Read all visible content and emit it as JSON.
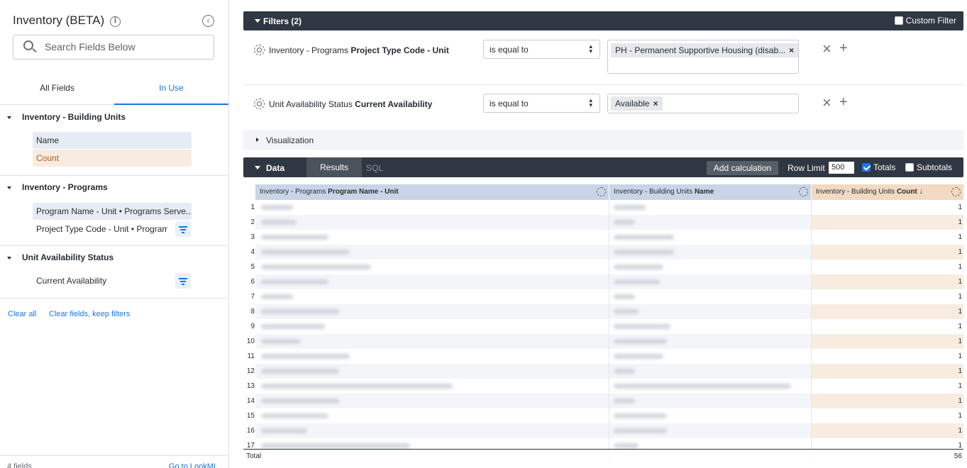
{
  "left_panel": {
    "title": "Inventory (BETA)",
    "info_glyph": "i",
    "collapse_glyph": "‹",
    "search_placeholder": "Search Fields Below",
    "tabs": {
      "all": "All Fields",
      "in_use": "In Use"
    },
    "groups": [
      {
        "title": "Inventory - Building Units",
        "fields": [
          "Name",
          "Count"
        ]
      },
      {
        "title": "Inventory - Programs",
        "fields": [
          "Program Name - Unit • Programs Serve...",
          "Project Type Code - Unit • Program..."
        ]
      },
      {
        "title": "Unit Availability Status",
        "fields": [
          "Current Availability"
        ]
      }
    ],
    "clear_all": "Clear all",
    "clear_fields": "Clear fields, keep filters",
    "fields_count": "4 fields",
    "go_to_lookml": "Go to LookML"
  },
  "filters": {
    "title": "Filters (2)",
    "custom_filter": "Custom Filter",
    "rows": [
      {
        "label_prefix": "Inventory - Programs ",
        "label_field": "Project Type Code - Unit",
        "operator": "is equal to",
        "value": "PH - Permanent Supportive Housing (disab..."
      },
      {
        "label_prefix": "Unit Availability Status ",
        "label_field": "Current Availability",
        "operator": "is equal to",
        "value": "Available"
      }
    ],
    "remove_glyph": "×",
    "add_glyph": "+",
    "select_arrows": "▲▼"
  },
  "visualization": {
    "label": "Visualization"
  },
  "data_bar": {
    "title": "Data",
    "tab_results": "Results",
    "tab_sql": "SQL",
    "add_calculation": "Add calculation",
    "row_limit_label": "Row Limit",
    "row_limit_value": "500",
    "totals": "Totals",
    "subtotals": "Subtotals",
    "totals_checked": true,
    "subtotals_checked": false
  },
  "table": {
    "columns": [
      {
        "prefix": "Inventory - Programs ",
        "field": "Program Name - Unit"
      },
      {
        "prefix": "Inventory - Building Units ",
        "field": "Name"
      },
      {
        "prefix": "Inventory - Building Units ",
        "field": "Count ↓"
      }
    ],
    "rows": [
      {
        "n": "1",
        "count": "1"
      },
      {
        "n": "2",
        "count": "1"
      },
      {
        "n": "3",
        "count": "1"
      },
      {
        "n": "4",
        "count": "1"
      },
      {
        "n": "5",
        "count": "1"
      },
      {
        "n": "6",
        "count": "1"
      },
      {
        "n": "7",
        "count": "1"
      },
      {
        "n": "8",
        "count": "1"
      },
      {
        "n": "9",
        "count": "1"
      },
      {
        "n": "10",
        "count": "1"
      },
      {
        "n": "11",
        "count": "1"
      },
      {
        "n": "12",
        "count": "1"
      },
      {
        "n": "13",
        "count": "1"
      },
      {
        "n": "14",
        "count": "1"
      },
      {
        "n": "15",
        "count": "1"
      },
      {
        "n": "16",
        "count": "1"
      },
      {
        "n": "17",
        "count": "1"
      }
    ],
    "total_label": "Total",
    "total_value": "56"
  }
}
